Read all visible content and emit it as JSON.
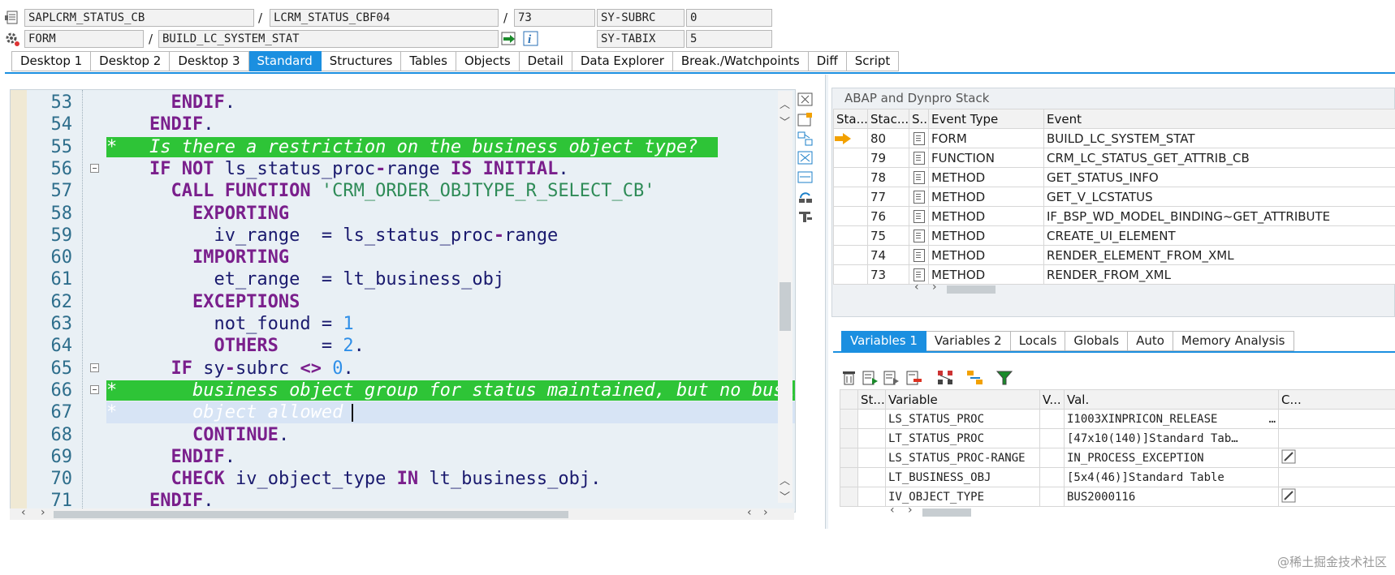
{
  "header": {
    "row1": {
      "program": "SAPLCRM_STATUS_CB",
      "include": "LCRM_STATUS_CBF04",
      "line": "73",
      "sysvar_name": "SY-SUBRC",
      "sysvar_value": "0"
    },
    "row2": {
      "event_type": "FORM",
      "event_name": "BUILD_LC_SYSTEM_STAT",
      "sysvar_name": "SY-TABIX",
      "sysvar_value": "5"
    },
    "sep": "/"
  },
  "tabs": [
    "Desktop 1",
    "Desktop 2",
    "Desktop 3",
    "Standard",
    "Structures",
    "Tables",
    "Objects",
    "Detail",
    "Data Explorer",
    "Break./Watchpoints",
    "Diff",
    "Script"
  ],
  "active_tab": "Standard",
  "code": {
    "lines": [
      {
        "n": "53",
        "fold": false,
        "html": "      <span class='kw'>ENDIF</span>."
      },
      {
        "n": "54",
        "fold": false,
        "html": "    <span class='kw'>ENDIF</span>."
      },
      {
        "n": "55",
        "fold": false,
        "hl": "green",
        "html": "<span class='cmt'>*   Is there a restriction on the business object type?</span>"
      },
      {
        "n": "56",
        "fold": true,
        "html": "    <span class='kw'>IF NOT</span> ls_status_proc<span class='kw'>-</span>range <span class='kw'>IS INITIAL</span>."
      },
      {
        "n": "57",
        "fold": false,
        "html": "      <span class='kw'>CALL FUNCTION</span> <span class='str'>'CRM_ORDER_OBJTYPE_R_SELECT_CB'</span>"
      },
      {
        "n": "58",
        "fold": false,
        "html": "        <span class='kw'>EXPORTING</span>"
      },
      {
        "n": "59",
        "fold": false,
        "html": "          iv_range  = ls_status_proc<span class='kw'>-</span>range"
      },
      {
        "n": "60",
        "fold": false,
        "html": "        <span class='kw'>IMPORTING</span>"
      },
      {
        "n": "61",
        "fold": false,
        "html": "          et_range  = lt_business_obj"
      },
      {
        "n": "62",
        "fold": false,
        "html": "        <span class='kw'>EXCEPTIONS</span>"
      },
      {
        "n": "63",
        "fold": false,
        "html": "          not_found = <span class='num'>1</span>"
      },
      {
        "n": "64",
        "fold": false,
        "html": "          <span class='kw'>OTHERS</span>    = <span class='num'>2</span>."
      },
      {
        "n": "65",
        "fold": true,
        "html": "      <span class='kw'>IF</span> sy<span class='kw'>-</span>subrc <span class='kw'>&lt;&gt;</span> <span class='num'>0</span>."
      },
      {
        "n": "66",
        "fold": true,
        "hl": "green",
        "html": "<span class='cmt'>*       business object group for status maintained, but no business</span>"
      },
      {
        "n": "67",
        "fold": false,
        "hl": "cursor",
        "html": "<span class='cmt-light'>*       object allowed</span>"
      },
      {
        "n": "68",
        "fold": false,
        "html": "        <span class='kw'>CONTINUE</span>."
      },
      {
        "n": "69",
        "fold": false,
        "html": "      <span class='kw'>ENDIF</span>."
      },
      {
        "n": "70",
        "fold": false,
        "html": "      <span class='kw'>CHECK</span> iv_object_type <span class='kw'>IN</span> lt_business_obj."
      },
      {
        "n": "71",
        "fold": false,
        "html": "    <span class='kw'>ENDIF</span>."
      }
    ]
  },
  "stack": {
    "title": "ABAP and Dynpro Stack",
    "columns": [
      "Sta...",
      "Stac...",
      "S..",
      "Event Type",
      "Event"
    ],
    "rows": [
      {
        "current": true,
        "level": "80",
        "type": "FORM",
        "event": "BUILD_LC_SYSTEM_STAT"
      },
      {
        "current": false,
        "level": "79",
        "type": "FUNCTION",
        "event": "CRM_LC_STATUS_GET_ATTRIB_CB"
      },
      {
        "current": false,
        "level": "78",
        "type": "METHOD",
        "event": "GET_STATUS_INFO"
      },
      {
        "current": false,
        "level": "77",
        "type": "METHOD",
        "event": "GET_V_LCSTATUS"
      },
      {
        "current": false,
        "level": "76",
        "type": "METHOD",
        "event": "IF_BSP_WD_MODEL_BINDING~GET_ATTRIBUTE"
      },
      {
        "current": false,
        "level": "75",
        "type": "METHOD",
        "event": "CREATE_UI_ELEMENT"
      },
      {
        "current": false,
        "level": "74",
        "type": "METHOD",
        "event": "RENDER_ELEMENT_FROM_XML"
      },
      {
        "current": false,
        "level": "73",
        "type": "METHOD",
        "event": "RENDER_FROM_XML"
      }
    ]
  },
  "var_tabs": [
    "Variables 1",
    "Variables 2",
    "Locals",
    "Globals",
    "Auto",
    "Memory Analysis"
  ],
  "active_var_tab": "Variables 1",
  "variables": {
    "columns": [
      "St...",
      "Variable",
      "V...",
      "Val.",
      "C..."
    ],
    "rows": [
      {
        "name": "LS_STATUS_PROC",
        "value": "I1003XINPRICON_RELEASE",
        "more": "…",
        "edit": false
      },
      {
        "name": "LT_STATUS_PROC",
        "value": "[47x10(140)]Standard Tab…",
        "more": "",
        "edit": false
      },
      {
        "name": "LS_STATUS_PROC-RANGE",
        "value": "IN_PROCESS_EXCEPTION",
        "more": "",
        "edit": true
      },
      {
        "name": "LT_BUSINESS_OBJ",
        "value": "[5x4(46)]Standard Table",
        "more": "",
        "edit": false
      },
      {
        "name": "IV_OBJECT_TYPE",
        "value": "BUS2000116",
        "more": "",
        "edit": true
      }
    ]
  },
  "watermark": "@稀土掘金技术社区",
  "colors": {
    "accent": "#1b8fe0",
    "highlight_green": "#2ec437",
    "cursor_line": "#d7e4f5",
    "keyword": "#7a1f8c"
  }
}
